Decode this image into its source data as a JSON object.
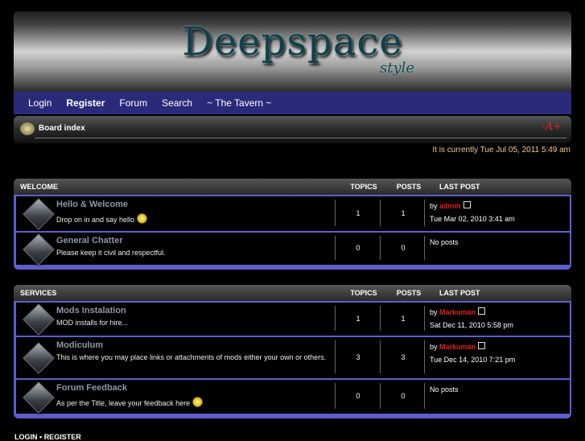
{
  "banner": {
    "logo_text": "Deepspace",
    "logo_sub": "style"
  },
  "nav": {
    "items": [
      "Login",
      "Register",
      "Forum",
      "Search",
      "~ The Tavern ~"
    ]
  },
  "breadcrumb": {
    "label": "Board index"
  },
  "datetime": "It is currently Tue Jul 05, 2011 5:49 am",
  "headers": {
    "topics": "TOPICS",
    "posts": "POSTS",
    "last_post": "LAST POST"
  },
  "categories": [
    {
      "title": "WELCOME",
      "forums": [
        {
          "name": "Hello & Welcome",
          "desc": "Drop on in and say hello",
          "topics": "1",
          "posts": "1",
          "by": "by",
          "author": "admin",
          "date": "Tue Mar 02, 2010 3:41 am"
        },
        {
          "name": "General Chatter",
          "desc": "Please keep it civil and respectful.",
          "topics": "0",
          "posts": "0",
          "no_posts": "No posts"
        }
      ]
    },
    {
      "title": "SERVICES",
      "forums": [
        {
          "name": "Mods Instalation",
          "desc": "MOD installs for hire...",
          "topics": "1",
          "posts": "1",
          "by": "by",
          "author": "Markuman",
          "date": "Sat Dec 11, 2010 5:58 pm"
        },
        {
          "name": "Modiculum",
          "desc": "This is where you may place links or attachments of mods either your own or others.",
          "topics": "3",
          "posts": "3",
          "by": "by",
          "author": "Markuman",
          "date": "Tue Dec 14, 2010 7:21 pm"
        },
        {
          "name": "Forum Feedback",
          "desc": "As per the Title, leave your feedback here",
          "topics": "0",
          "posts": "0",
          "no_posts": "No posts"
        }
      ]
    }
  ],
  "bottom": {
    "login": "LOGIN",
    "sep": "•",
    "register": "REGISTER"
  },
  "colors": {
    "nav": "#2a2a7a",
    "accent_border": "#5e5ec8",
    "author": "#e0201e",
    "datetime": "#f5c98a"
  }
}
